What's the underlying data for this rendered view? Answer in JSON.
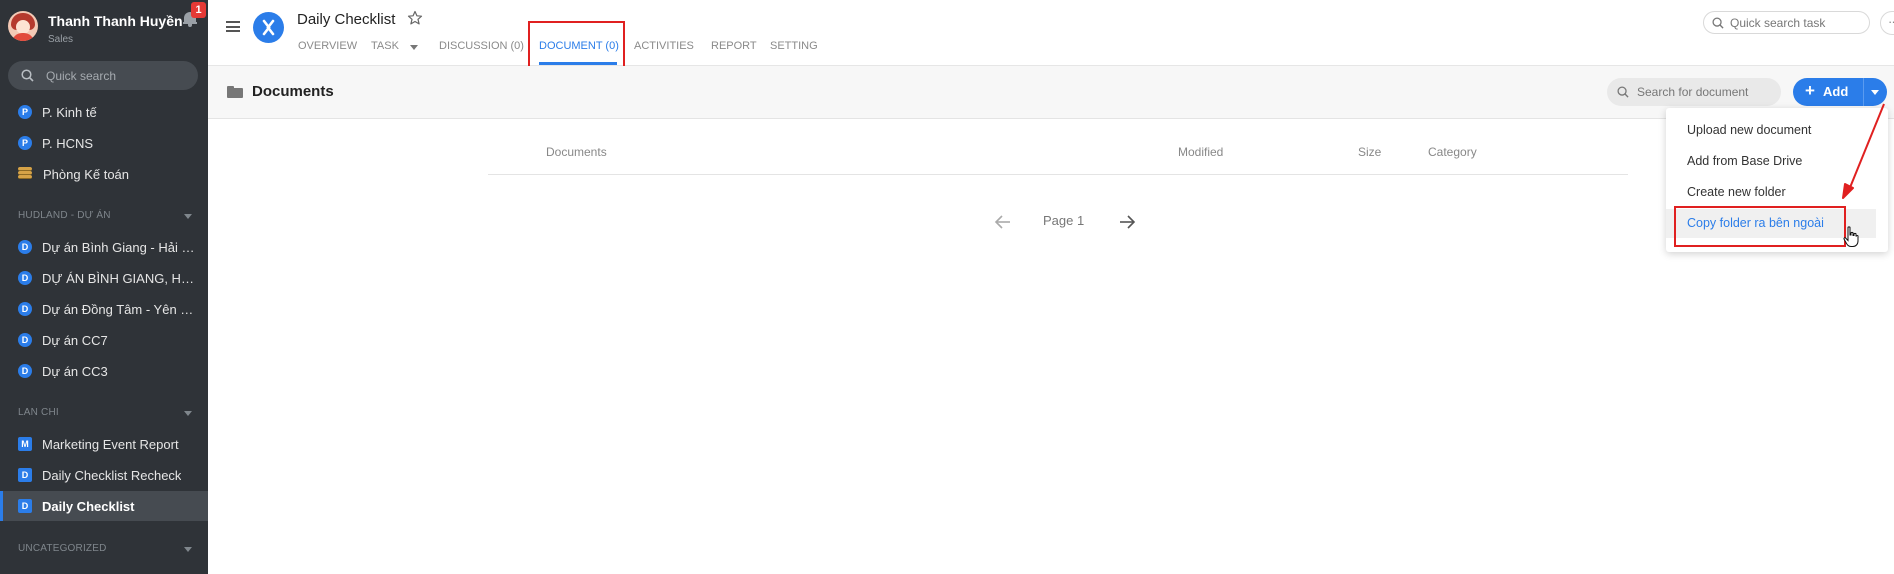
{
  "user": {
    "name": "Thanh Thanh Huyền",
    "role": "Sales",
    "notification_count": "1"
  },
  "sidebar": {
    "search_placeholder": "Quick search",
    "items_top": [
      {
        "badge": "P",
        "label": "P. Kinh tế"
      },
      {
        "badge": "P",
        "label": "P. HCNS"
      },
      {
        "icon": "coins-icon",
        "label": "Phòng Kế toán"
      }
    ],
    "section_hudland": {
      "title": "HUDLAND - DỰ ÁN",
      "items": [
        {
          "badge": "D",
          "label": "Dự án Bình Giang - Hải D..."
        },
        {
          "badge": "D",
          "label": "DỰ ÁN BÌNH GIANG, HẢI ..."
        },
        {
          "badge": "D",
          "label": "Dự án Đồng Tâm - Yên Bái"
        },
        {
          "badge": "D",
          "label": "Dự án CC7"
        },
        {
          "badge": "D",
          "label": "Dự án CC3"
        }
      ]
    },
    "section_lanchi": {
      "title": "LAN CHI",
      "items": [
        {
          "badge": "M",
          "label": "Marketing Event Report"
        },
        {
          "badge": "D",
          "label": "Daily Checklist Recheck"
        },
        {
          "badge": "D",
          "label": "Daily Checklist"
        }
      ]
    },
    "section_uncategorized": {
      "title": "UNCATEGORIZED"
    }
  },
  "header": {
    "title": "Daily Checklist",
    "tabs": [
      {
        "label": "OVERVIEW"
      },
      {
        "label": "TASK"
      },
      {
        "label": "DISCUSSION (0)"
      },
      {
        "label": "DOCUMENT (0)"
      },
      {
        "label": "ACTIVITIES"
      },
      {
        "label": "REPORT"
      },
      {
        "label": "SETTING"
      }
    ],
    "search_placeholder": "Quick search task",
    "more_label": "···"
  },
  "documents": {
    "title": "Documents",
    "search_placeholder": "Search for document",
    "add_label": "Add",
    "columns": [
      "Documents",
      "Modified",
      "Size",
      "Category"
    ],
    "page_label": "Page 1",
    "dropdown": [
      "Upload new document",
      "Add from Base Drive",
      "Create new folder",
      "Copy folder ra bên ngoài"
    ]
  },
  "colors": {
    "accent": "#2b7de9",
    "sidebar_bg": "#2f3338",
    "highlight": "#e02020"
  }
}
